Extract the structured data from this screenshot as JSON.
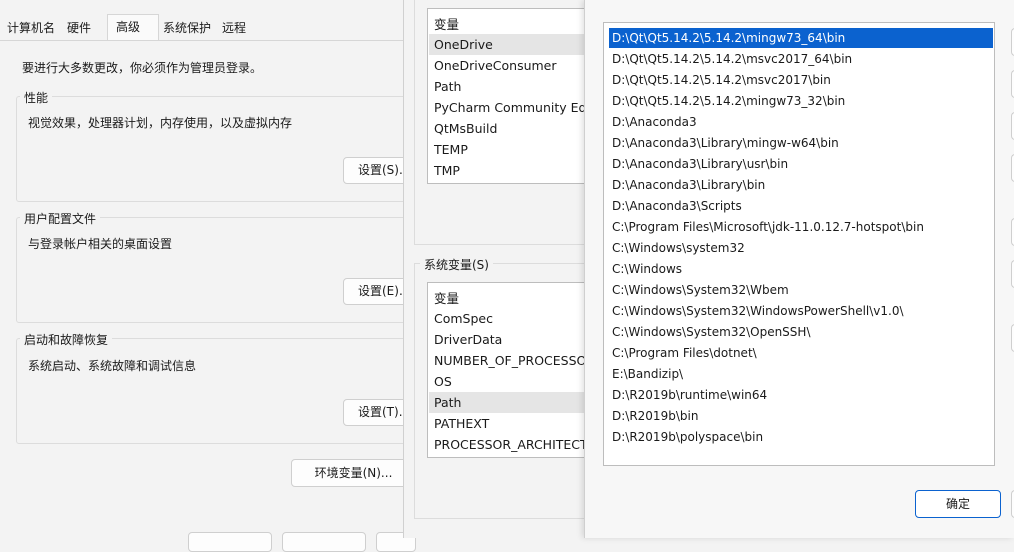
{
  "system_properties": {
    "tabs": [
      "计算机名",
      "硬件",
      "高级",
      "系统保护",
      "远程"
    ],
    "admin_notice": "要进行大多数更改，你必须作为管理员登录。",
    "performance": {
      "label": "性能",
      "description": "视觉效果，处理器计划，内存使用，以及虚拟内存",
      "button": "设置(S)..."
    },
    "user_profiles": {
      "label": "用户配置文件",
      "description": "与登录帐户相关的桌面设置",
      "button": "设置(E)..."
    },
    "startup_recovery": {
      "label": "启动和故障恢复",
      "description": "系统启动、系统故障和调试信息",
      "button": "设置(T)..."
    },
    "env_button": "环境变量(N)..."
  },
  "environment_variables": {
    "user_vars": {
      "header": "变量",
      "items": [
        "OneDrive",
        "OneDriveConsumer",
        "Path",
        "PyCharm Community Editi",
        "QtMsBuild",
        "TEMP",
        "TMP"
      ]
    },
    "system_section_label": "系统变量(S)",
    "system_vars": {
      "header": "变量",
      "items": [
        "ComSpec",
        "DriverData",
        "NUMBER_OF_PROCESSOR",
        "OS",
        "Path",
        "PATHEXT",
        "PROCESSOR_ARCHITECT..."
      ]
    }
  },
  "edit_path": {
    "entries": [
      "D:\\Qt\\Qt5.14.2\\5.14.2\\mingw73_64\\bin",
      "D:\\Qt\\Qt5.14.2\\5.14.2\\msvc2017_64\\bin",
      "D:\\Qt\\Qt5.14.2\\5.14.2\\msvc2017\\bin",
      "D:\\Qt\\Qt5.14.2\\5.14.2\\mingw73_32\\bin",
      "D:\\Anaconda3",
      "D:\\Anaconda3\\Library\\mingw-w64\\bin",
      "D:\\Anaconda3\\Library\\usr\\bin",
      "D:\\Anaconda3\\Library\\bin",
      "D:\\Anaconda3\\Scripts",
      "C:\\Program Files\\Microsoft\\jdk-11.0.12.7-hotspot\\bin",
      "C:\\Windows\\system32",
      "C:\\Windows",
      "C:\\Windows\\System32\\Wbem",
      "C:\\Windows\\System32\\WindowsPowerShell\\v1.0\\",
      "C:\\Windows\\System32\\OpenSSH\\",
      "C:\\Program Files\\dotnet\\",
      "E:\\Bandizip\\",
      "D:\\R2019b\\runtime\\win64",
      "D:\\R2019b\\bin",
      "D:\\R2019b\\polyspace\\bin"
    ],
    "ok_button": "确定",
    "colors": {
      "selection": "#0b62cf",
      "ok_border": "#0b62cf"
    }
  }
}
